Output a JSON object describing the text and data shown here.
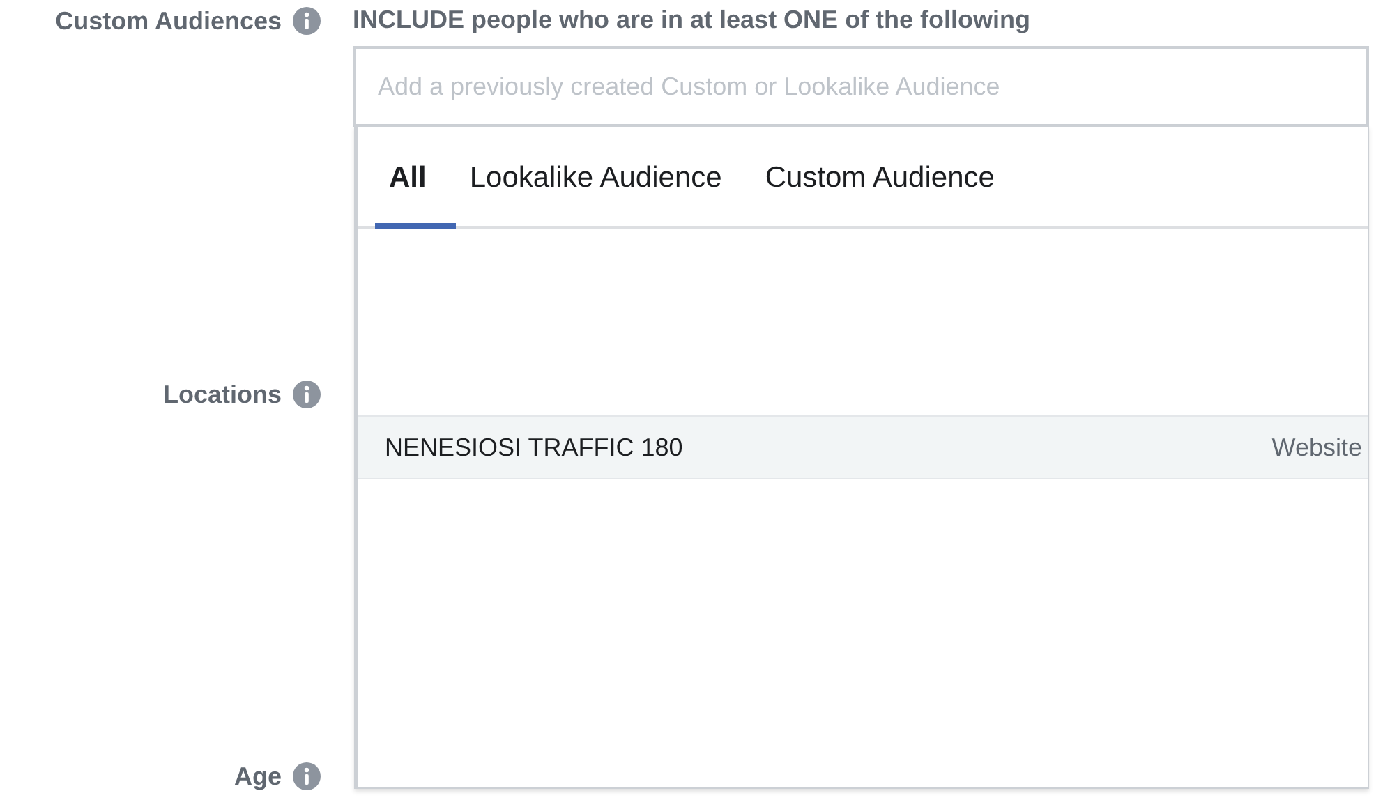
{
  "form_rows": [
    {
      "label": "Custom Audiences"
    },
    {
      "label": "Locations"
    },
    {
      "label": "Age"
    }
  ],
  "include_heading": "INCLUDE people who are in at least ONE of the following",
  "search": {
    "placeholder": "Add a previously created Custom or Lookalike Audience"
  },
  "dropdown": {
    "tabs": [
      {
        "label": "All",
        "selected": true
      },
      {
        "label": "Lookalike Audience",
        "selected": false
      },
      {
        "label": "Custom Audience",
        "selected": false
      }
    ],
    "audiences": [
      {
        "name": "NENESIOSI TRAFFIC 180",
        "type": "Website",
        "selected": true
      }
    ]
  }
}
